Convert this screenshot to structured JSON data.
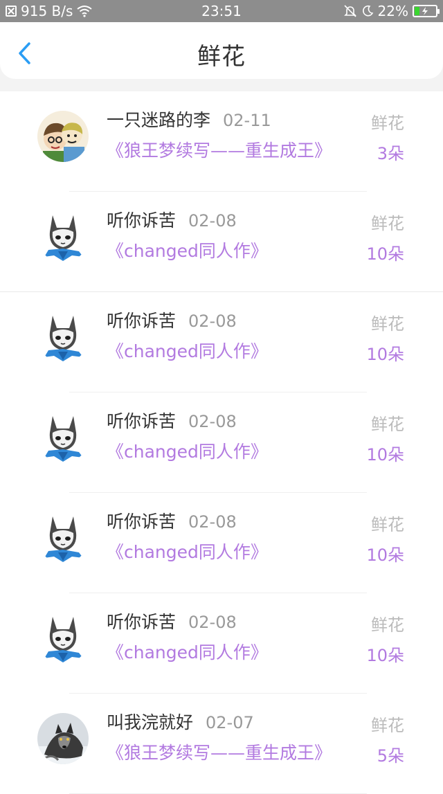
{
  "status_bar": {
    "speed": "915 B/s",
    "time": "23:51",
    "battery": "22%",
    "battery_level": 0.22,
    "icons": [
      "notification-icon",
      "wifi-icon",
      "mute-bell-icon",
      "moon-icon",
      "battery-charging-icon"
    ]
  },
  "header": {
    "title": "鲜花",
    "back_icon": "chevron-left-icon"
  },
  "colors": {
    "accent_purple": "#b27ae0",
    "back_blue": "#2a9df4",
    "status_bar": "#8d8d8d",
    "battery_green": "#3ad52f"
  },
  "rows": [
    {
      "user": "一只迷路的李",
      "date": "02-11",
      "book": "《狼王梦续写——重生成王》",
      "gift": "鲜花",
      "count": "3朵",
      "avatar": "cartoon-duo-avatar"
    },
    {
      "user": "听你诉苦",
      "date": "02-08",
      "book": "《changed同人作》",
      "gift": "鲜花",
      "count": "10朵",
      "avatar": "wolf-character-avatar"
    },
    {
      "user": "听你诉苦",
      "date": "02-08",
      "book": "《changed同人作》",
      "gift": "鲜花",
      "count": "10朵",
      "avatar": "wolf-character-avatar"
    },
    {
      "user": "听你诉苦",
      "date": "02-08",
      "book": "《changed同人作》",
      "gift": "鲜花",
      "count": "10朵",
      "avatar": "wolf-character-avatar"
    },
    {
      "user": "听你诉苦",
      "date": "02-08",
      "book": "《changed同人作》",
      "gift": "鲜花",
      "count": "10朵",
      "avatar": "wolf-character-avatar"
    },
    {
      "user": "听你诉苦",
      "date": "02-08",
      "book": "《changed同人作》",
      "gift": "鲜花",
      "count": "10朵",
      "avatar": "wolf-character-avatar"
    },
    {
      "user": "叫我浣就好",
      "date": "02-07",
      "book": "《狼王梦续写——重生成王》",
      "gift": "鲜花",
      "count": "5朵",
      "avatar": "wolf-photo-avatar"
    }
  ]
}
